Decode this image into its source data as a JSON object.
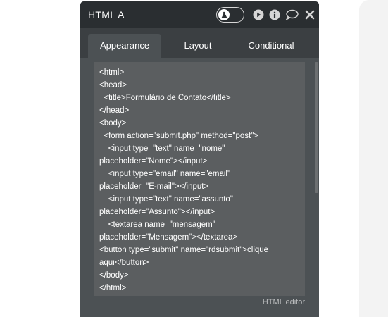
{
  "panel": {
    "title": "HTML A",
    "tabs": [
      {
        "label": "Appearance",
        "active": true
      },
      {
        "label": "Layout",
        "active": false
      },
      {
        "label": "Conditional",
        "active": false
      }
    ],
    "header_icons": [
      "flask-icon",
      "play-icon",
      "info-icon",
      "comment-icon",
      "close-icon"
    ]
  },
  "editor": {
    "code": "<html>\n<head>\n  <title>Formulário de Contato</title>\n</head>\n<body>\n  <form action=\"submit.php\" method=\"post\">\n    <input type=\"text\" name=\"nome\"\nplaceholder=\"Nome\"></input>\n    <input type=\"email\" name=\"email\"\nplaceholder=\"E-mail\"></input>\n    <input type=\"text\" name=\"assunto\"\nplaceholder=\"Assunto\"></input>\n    <textarea name=\"mensagem\"\nplaceholder=\"Mensagem\"></textarea>\n<button type=\"submit\" name=\"rdsubmit\">clique\naqui</button>\n</body>\n</html>",
    "label": "HTML editor"
  },
  "colors": {
    "header_bg": "#2a2e31",
    "tab_bar_bg": "#3b3f42",
    "content_bg": "#4c5154",
    "editor_bg": "#5b5e60",
    "text": "#ffffff",
    "muted_text": "#b8babb"
  }
}
